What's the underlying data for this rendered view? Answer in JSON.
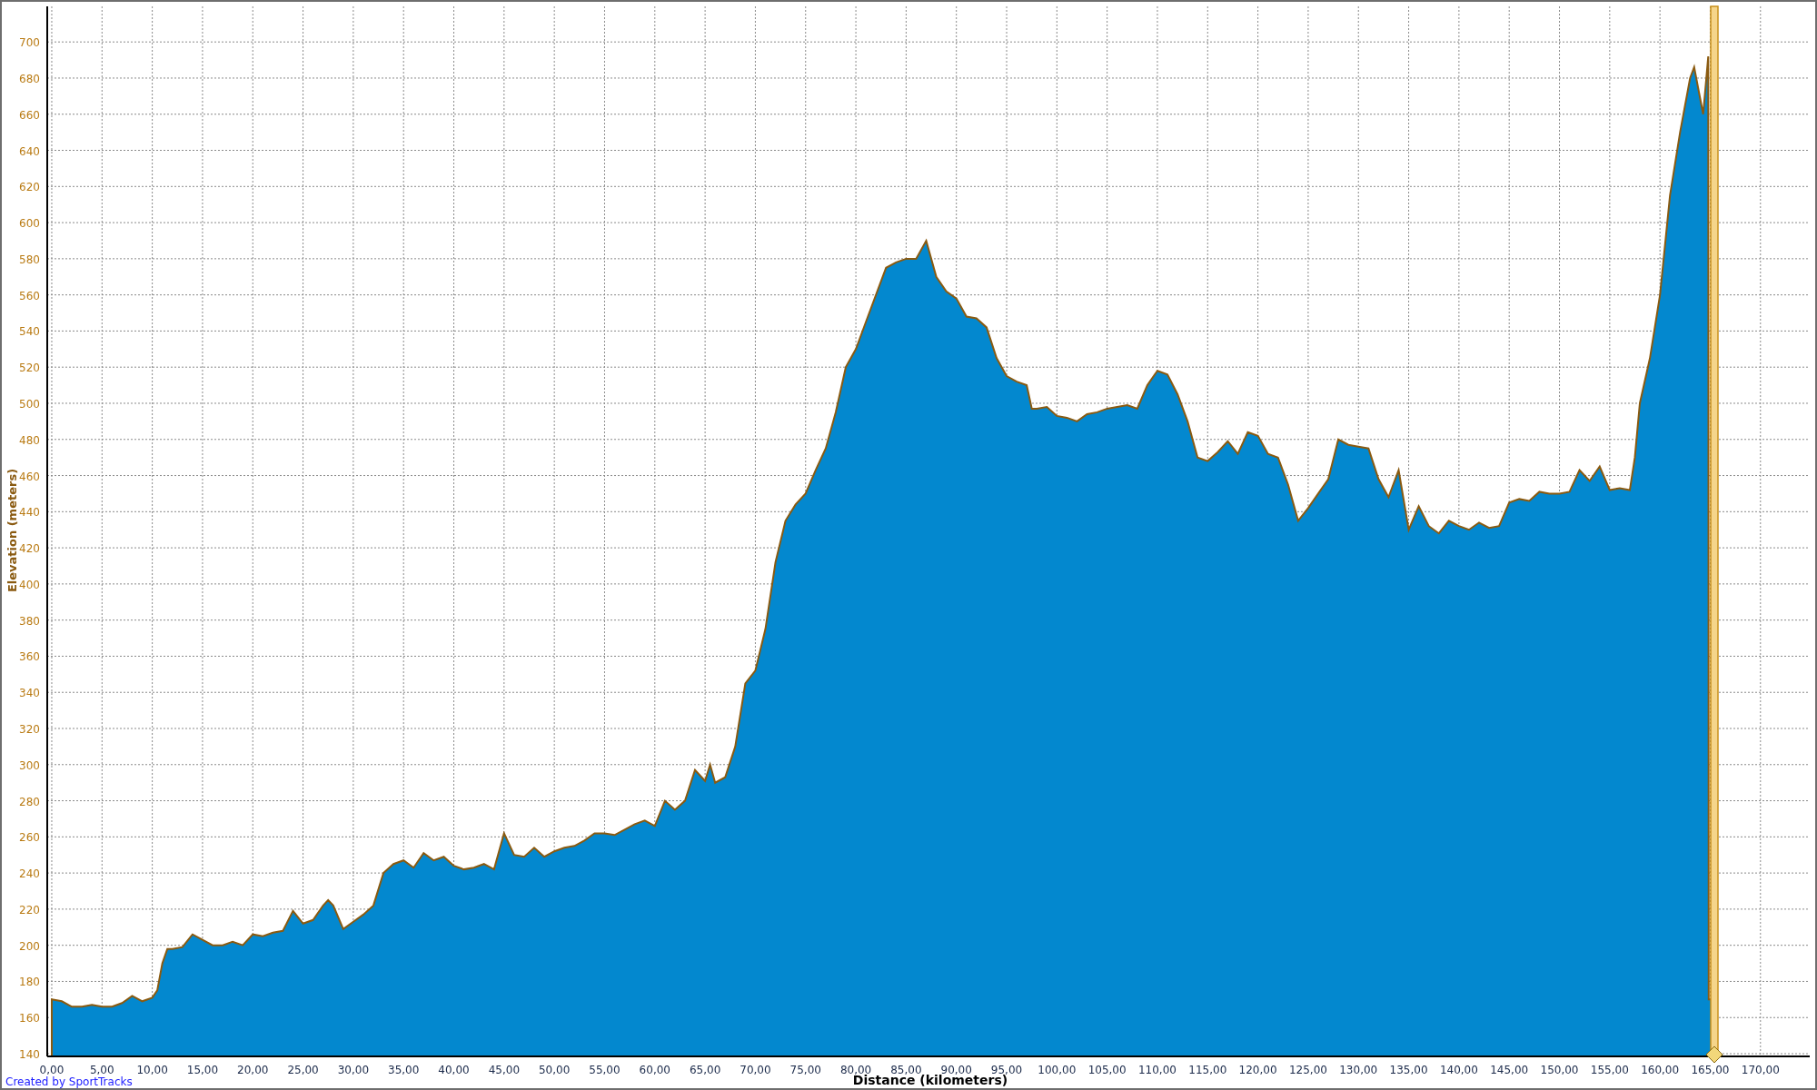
{
  "chart_data": {
    "type": "area",
    "grid": true,
    "xlabel": "Distance (kilometers)",
    "ylabel": "Elevation (meters)",
    "x": [
      0,
      1,
      2,
      3,
      4,
      5,
      6,
      7,
      8,
      9,
      10,
      10.5,
      11,
      11.5,
      12,
      13,
      14,
      15,
      16,
      17,
      18,
      19,
      20,
      21,
      22,
      23,
      24,
      25,
      26,
      27,
      27.5,
      28,
      29,
      30,
      31,
      32,
      33,
      34,
      35,
      36,
      37,
      38,
      39,
      40,
      41,
      42,
      43,
      44,
      45,
      46,
      47,
      48,
      49,
      50,
      51,
      52,
      53,
      54,
      55,
      56,
      57,
      58,
      59,
      60,
      61,
      62,
      63,
      64,
      65,
      65.5,
      66,
      67,
      68,
      69,
      70,
      71,
      72,
      73,
      74,
      75,
      76,
      77,
      78,
      79,
      80,
      81,
      82,
      83,
      84,
      85,
      86,
      87,
      88,
      89,
      90,
      91,
      92,
      93,
      94,
      95,
      96,
      97,
      97.5,
      98,
      99,
      100,
      101,
      102,
      103,
      104,
      105,
      106,
      107,
      108,
      109,
      110,
      111,
      112,
      113,
      114,
      115,
      116,
      117,
      118,
      119,
      120,
      121,
      122,
      123,
      124,
      125,
      126,
      127,
      128,
      129,
      130,
      131,
      132,
      133,
      134,
      135,
      136,
      137,
      138,
      139,
      140,
      141,
      142,
      143,
      144,
      145,
      146,
      147,
      148,
      149,
      150,
      151,
      152,
      153,
      154,
      155,
      156,
      157,
      157.5,
      158,
      159,
      160,
      161,
      162,
      163,
      163.4,
      164.3,
      164.8,
      164.85,
      165.2
    ],
    "series": [
      {
        "color": "#0388cf",
        "values": [
          170,
          169,
          166,
          166,
          167,
          166,
          166,
          168,
          172,
          169,
          171,
          175,
          190,
          198,
          198,
          199,
          206,
          203,
          200,
          200,
          202,
          200,
          206,
          205,
          207,
          208,
          219,
          212,
          214,
          222,
          225,
          222,
          209,
          213,
          217,
          222,
          240,
          245,
          247,
          243,
          251,
          247,
          249,
          244,
          242,
          243,
          245,
          242,
          262,
          250,
          249,
          254,
          249,
          252,
          254,
          255,
          258,
          262,
          262,
          261,
          264,
          267,
          269,
          266,
          280,
          275,
          280,
          297,
          291,
          300,
          290,
          293,
          310,
          345,
          352,
          375,
          412,
          435,
          444,
          450,
          463,
          475,
          495,
          520,
          530,
          545,
          560,
          575,
          578,
          580,
          580,
          590,
          570,
          562,
          558,
          548,
          547,
          542,
          525,
          515,
          512,
          510,
          497,
          497,
          498,
          493,
          492,
          490,
          494,
          495,
          497,
          498,
          499,
          497,
          510,
          518,
          516,
          505,
          490,
          470,
          468,
          473,
          479,
          472,
          484,
          482,
          472,
          470,
          455,
          435,
          442,
          450,
          458,
          480,
          477,
          476,
          475,
          458,
          448,
          463,
          430,
          443,
          432,
          428,
          435,
          432,
          430,
          434,
          431,
          432,
          445,
          447,
          446,
          451,
          450,
          450,
          451,
          463,
          457,
          465,
          452,
          453,
          452,
          470,
          500,
          525,
          560,
          615,
          650,
          680,
          686,
          660,
          692,
          170,
          170
        ]
      }
    ],
    "xlim": [
      -0.45,
      174.9
    ],
    "ylim": [
      138.5,
      719.7
    ],
    "xticks": [
      {
        "value": 0,
        "label": "0,00"
      },
      {
        "value": 5,
        "label": "5,00"
      },
      {
        "value": 10,
        "label": "10,00"
      },
      {
        "value": 15,
        "label": "15,00"
      },
      {
        "value": 20,
        "label": "20,00"
      },
      {
        "value": 25,
        "label": "25,00"
      },
      {
        "value": 30,
        "label": "30,00"
      },
      {
        "value": 35,
        "label": "35,00"
      },
      {
        "value": 40,
        "label": "40,00"
      },
      {
        "value": 45,
        "label": "45,00"
      },
      {
        "value": 50,
        "label": "50,00"
      },
      {
        "value": 55,
        "label": "55,00"
      },
      {
        "value": 60,
        "label": "60,00"
      },
      {
        "value": 65,
        "label": "65,00"
      },
      {
        "value": 70,
        "label": "70,00"
      },
      {
        "value": 75,
        "label": "75,00"
      },
      {
        "value": 80,
        "label": "80,00"
      },
      {
        "value": 85,
        "label": "85,00"
      },
      {
        "value": 90,
        "label": "90,00"
      },
      {
        "value": 95,
        "label": "95,00"
      },
      {
        "value": 100,
        "label": "100,00"
      },
      {
        "value": 105,
        "label": "105,00"
      },
      {
        "value": 110,
        "label": "110,00"
      },
      {
        "value": 115,
        "label": "115,00"
      },
      {
        "value": 120,
        "label": "120,00"
      },
      {
        "value": 125,
        "label": "125,00"
      },
      {
        "value": 130,
        "label": "130,00"
      },
      {
        "value": 135,
        "label": "135,00"
      },
      {
        "value": 140,
        "label": "140,00"
      },
      {
        "value": 145,
        "label": "145,00"
      },
      {
        "value": 150,
        "label": "150,00"
      },
      {
        "value": 155,
        "label": "155,00"
      },
      {
        "value": 160,
        "label": "160,00"
      },
      {
        "value": 165,
        "label": "165,00"
      },
      {
        "value": 170,
        "label": "170,00"
      }
    ],
    "yticks": [
      140,
      160,
      180,
      200,
      220,
      240,
      260,
      280,
      300,
      320,
      340,
      360,
      380,
      400,
      420,
      440,
      460,
      480,
      500,
      520,
      540,
      560,
      580,
      600,
      620,
      640,
      660,
      680,
      700
    ]
  },
  "footer": {
    "link": "Created by SportTracks"
  }
}
